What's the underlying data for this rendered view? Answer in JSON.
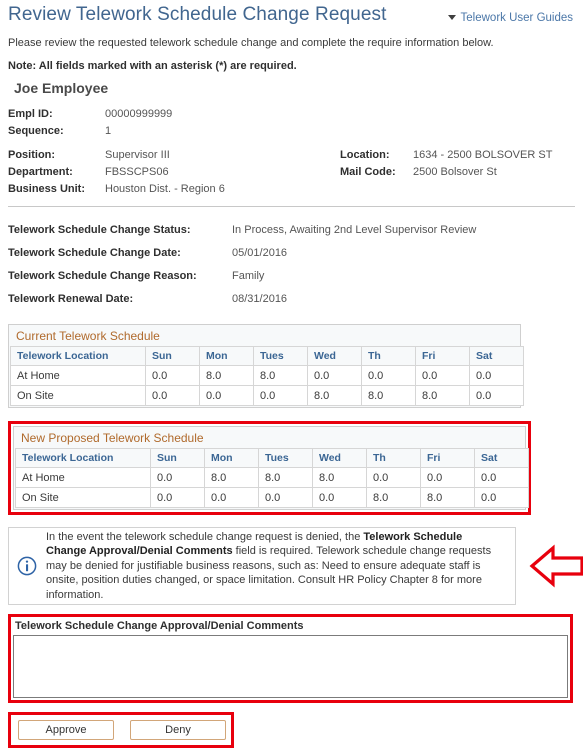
{
  "header": {
    "title": "Review Telework Schedule Change Request",
    "guides_link": "Telework User Guides",
    "caret_icon": "chevron-down-icon"
  },
  "intro": "Please review the requested telework schedule change and complete the require information below.",
  "note": "Note: All fields marked with an asterisk (*) are required.",
  "employee": {
    "name": "Joe Employee",
    "empl_id_label": "Empl ID:",
    "empl_id_value": "00000999999",
    "sequence_label": "Sequence:",
    "sequence_value": "1",
    "position_label": "Position:",
    "position_value": "Supervisor III",
    "department_label": "Department:",
    "department_value": "FBSSCPS06",
    "business_unit_label": "Business Unit:",
    "business_unit_value": "Houston Dist. - Region 6",
    "location_label": "Location:",
    "location_value": "1634 - 2500 BOLSOVER ST",
    "mail_code_label": "Mail Code:",
    "mail_code_value": "2500 Bolsover St"
  },
  "status": {
    "change_status_label": "Telework Schedule Change Status:",
    "change_status_value": "In Process, Awaiting 2nd Level Supervisor Review",
    "change_date_label": "Telework Schedule Change Date:",
    "change_date_value": "05/01/2016",
    "change_reason_label": "Telework Schedule Change Reason:",
    "change_reason_value": "Family",
    "renewal_date_label": "Telework Renewal Date:",
    "renewal_date_value": "08/31/2016"
  },
  "schedules": {
    "columns": [
      "Telework Location",
      "Sun",
      "Mon",
      "Tues",
      "Wed",
      "Th",
      "Fri",
      "Sat"
    ],
    "current": {
      "title": "Current Telework Schedule",
      "rows": [
        {
          "location": "At Home",
          "values": [
            "0.0",
            "8.0",
            "8.0",
            "0.0",
            "0.0",
            "0.0",
            "0.0"
          ]
        },
        {
          "location": "On Site",
          "values": [
            "0.0",
            "0.0",
            "0.0",
            "8.0",
            "8.0",
            "8.0",
            "0.0"
          ]
        }
      ]
    },
    "proposed": {
      "title": "New Proposed Telework Schedule",
      "rows": [
        {
          "location": "At Home",
          "values": [
            "0.0",
            "8.0",
            "8.0",
            "8.0",
            "0.0",
            "0.0",
            "0.0"
          ]
        },
        {
          "location": "On Site",
          "values": [
            "0.0",
            "0.0",
            "0.0",
            "0.0",
            "8.0",
            "8.0",
            "0.0"
          ]
        }
      ]
    }
  },
  "info_callout": {
    "icon": "info-circle-icon",
    "text_part1": "In the event the telework schedule change request is denied, the ",
    "text_bold": "Telework Schedule Change Approval/Denial Comments",
    "text_part2": " field is required. Telework schedule change requests may be denied for justifiable business reasons, such as: Need to ensure adequate staff is onsite, position duties changed, or space limitation. Consult HR Policy Chapter 8 for more information.",
    "arrow_icon": "arrow-left-icon"
  },
  "comments": {
    "label": "Telework Schedule Change Approval/Denial Comments",
    "value": "",
    "placeholder": ""
  },
  "actions": {
    "approve_label": "Approve",
    "deny_label": "Deny"
  },
  "colors": {
    "title_blue": "#41668f",
    "link_blue": "#4b77a8",
    "section_orange": "#b06a2c",
    "col_header_blue": "#3b6694",
    "highlight_red": "#e8000d",
    "button_border": "#d2a679"
  }
}
